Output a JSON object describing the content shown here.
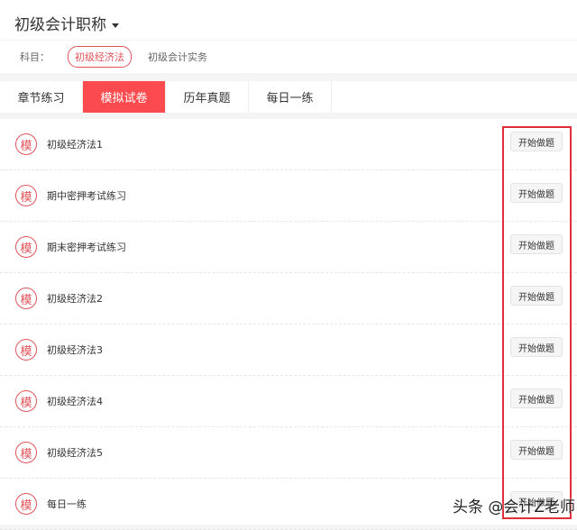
{
  "header": {
    "title": "初级会计职称"
  },
  "subjects": {
    "label": "科目：",
    "items": [
      "初级经济法",
      "初级会计实务"
    ]
  },
  "tabs": [
    "章节练习",
    "模拟试卷",
    "历年真题",
    "每日一练"
  ],
  "list": {
    "icon_char": "模",
    "button_label": "开始做题",
    "items": [
      "初级经济法1",
      "期中密押考试练习",
      "期末密押考试练习",
      "初级经济法2",
      "初级经济法3",
      "初级经济法4",
      "初级经济法5",
      "每日一练"
    ]
  },
  "watermark": "头条 @会计Z老师",
  "colors": {
    "accent": "#fb4b4e",
    "highlight_box": "#e0313a"
  }
}
